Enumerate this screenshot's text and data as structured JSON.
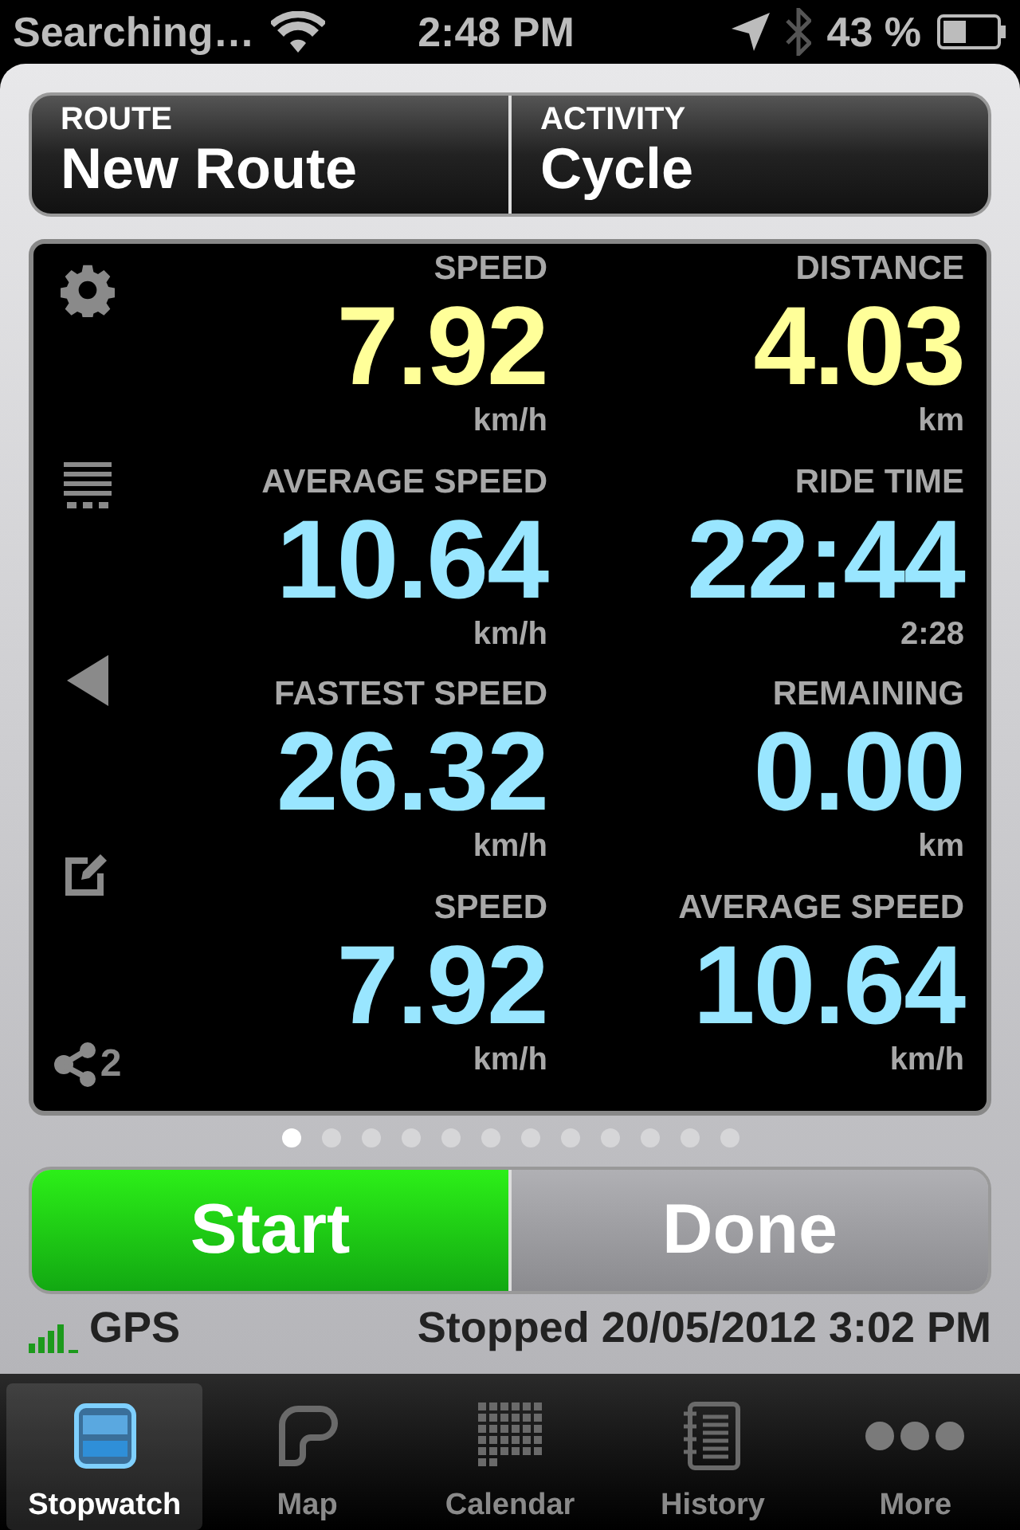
{
  "status_bar": {
    "carrier": "Searching…",
    "time": "2:48 PM",
    "battery": "43 %"
  },
  "header": [
    {
      "label": "ROUTE",
      "value": "New Route"
    },
    {
      "label": "ACTIVITY",
      "value": "Cycle"
    }
  ],
  "side_tools": [
    {
      "kind": "settings"
    },
    {
      "kind": "list"
    },
    {
      "kind": "back"
    },
    {
      "kind": "edit"
    },
    {
      "kind": "share",
      "badge": "2"
    }
  ],
  "metrics": [
    {
      "label": "SPEED",
      "value": "7.92",
      "unit": "km/h",
      "color": "#ffff99"
    },
    {
      "label": "DISTANCE",
      "value": "4.03",
      "unit": "km",
      "color": "#ffff99"
    },
    {
      "label": "AVERAGE SPEED",
      "value": "10.64",
      "unit": "km/h",
      "color": "#99e6ff"
    },
    {
      "label": "RIDE TIME",
      "value": "22:44",
      "unit": "2:28",
      "color": "#99e6ff"
    },
    {
      "label": "FASTEST SPEED",
      "value": "26.32",
      "unit": "km/h",
      "color": "#99e6ff"
    },
    {
      "label": "REMAINING",
      "value": "0.00",
      "unit": "km",
      "color": "#99e6ff"
    },
    {
      "label": "SPEED",
      "value": "7.92",
      "unit": "km/h",
      "color": "#99e6ff"
    },
    {
      "label": "AVERAGE SPEED",
      "value": "10.64",
      "unit": "km/h",
      "color": "#99e6ff"
    }
  ],
  "pages": [
    {
      "selected": true
    },
    {
      "selected": false
    },
    {
      "selected": false
    },
    {
      "selected": false
    },
    {
      "selected": false
    },
    {
      "selected": false
    },
    {
      "selected": false
    },
    {
      "selected": false
    },
    {
      "selected": false
    },
    {
      "selected": false
    },
    {
      "selected": false
    },
    {
      "selected": false
    }
  ],
  "buttons": [
    {
      "kind": "start",
      "label": "Start"
    },
    {
      "kind": "done",
      "label": "Done"
    }
  ],
  "footer": {
    "gps": "GPS",
    "status": "Stopped 20/05/2012 3:02 PM"
  },
  "tabs": [
    {
      "kind": "stopwatch",
      "label": "Stopwatch",
      "selected": true
    },
    {
      "kind": "map",
      "label": "Map",
      "selected": false
    },
    {
      "kind": "calendar",
      "label": "Calendar",
      "selected": false
    },
    {
      "kind": "history",
      "label": "History",
      "selected": false
    },
    {
      "kind": "more",
      "label": "More",
      "selected": false
    }
  ]
}
